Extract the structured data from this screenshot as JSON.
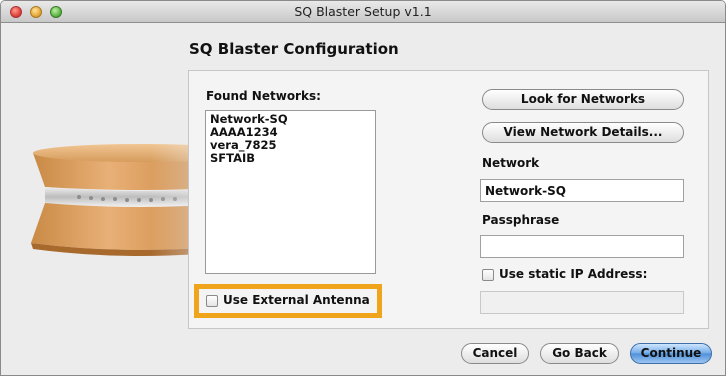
{
  "window": {
    "title": "SQ Blaster Setup v1.1"
  },
  "heading": "SQ Blaster Configuration",
  "networks": {
    "label": "Found Networks:",
    "items": [
      "Network-SQ",
      "AAAA1234",
      "vera_7825",
      "SFTAIB"
    ]
  },
  "antenna": {
    "label": "Use External Antenna",
    "checked": false
  },
  "actions": {
    "look_for_networks": "Look for Networks",
    "view_network_details": "View Network Details..."
  },
  "network_field": {
    "label": "Network",
    "value": "Network-SQ"
  },
  "passphrase_field": {
    "label": "Passphrase",
    "value": ""
  },
  "static_ip": {
    "label": "Use static IP Address:",
    "checked": false,
    "value": ""
  },
  "footer": {
    "cancel": "Cancel",
    "go_back": "Go Back",
    "continue": "Continue"
  },
  "colors": {
    "highlight": "#f0a41c",
    "primary_button": "#4f8fd9"
  }
}
